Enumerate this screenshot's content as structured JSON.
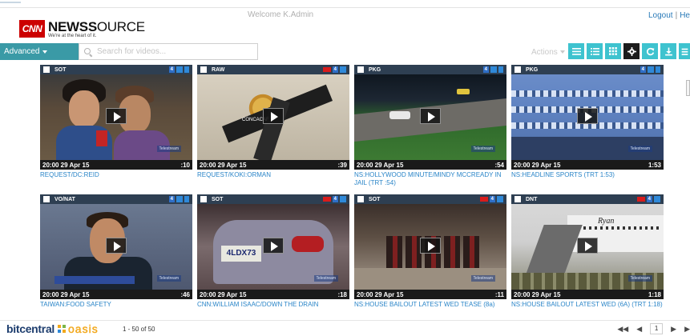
{
  "header": {
    "logo_box": "CNN",
    "logo_bold": "NEWS",
    "logo_light": "OURCE",
    "logo_s": "S",
    "tagline": "We're at the heart of it.",
    "welcome": "Welcome K.Admin",
    "logout": "Logout",
    "help": "He"
  },
  "toolbar": {
    "advanced_label": "Advanced",
    "search_placeholder": "Search for videos...",
    "actions_label": "Actions"
  },
  "cards": [
    {
      "tag": "SOT",
      "badge": "4",
      "timestamp": "20:00 29 Apr 15",
      "duration": ":10",
      "title": "REQUEST/DC:REID",
      "flag": false
    },
    {
      "tag": "RAW",
      "badge": "4",
      "timestamp": "20:00 29 Apr 15",
      "duration": ":39",
      "title": "REQUEST/KOKI:ORMAN",
      "flag": true
    },
    {
      "tag": "PKG",
      "badge": "4",
      "timestamp": "20:00 29 Apr 15",
      "duration": ":54",
      "title": "NS:HOLLYWOOD MINUTE/MINDY MCCREADY IN JAIL (TRT :54)",
      "flag": false
    },
    {
      "tag": "PKG",
      "badge": "4",
      "timestamp": "20:00 29 Apr 15",
      "duration": "1:53",
      "title": "NS:HEADLINE SPORTS (TRT 1:53)",
      "flag": false
    },
    {
      "tag": "VO/NAT",
      "badge": "4",
      "timestamp": "20:00 29 Apr 15",
      "duration": ":46",
      "title": "TAIWAN:FOOD SAFETY",
      "flag": false
    },
    {
      "tag": "SOT",
      "badge": "4",
      "timestamp": "20:00 29 Apr 15",
      "duration": ":18",
      "title": "CNN:WILLIAM ISAAC/DOWN THE DRAIN",
      "flag": true
    },
    {
      "tag": "SOT",
      "badge": "4",
      "timestamp": "20:00 29 Apr 15",
      "duration": ":11",
      "title": "NS:HOUSE BAILOUT LATEST WED TEASE (8a)",
      "flag": true
    },
    {
      "tag": "DNT",
      "badge": "4",
      "timestamp": "20:00 29 Apr 15",
      "duration": "1:18",
      "title": "NS:HOUSE BAILOUT LATEST WED (6A) (TRT 1:18)",
      "flag": true
    }
  ],
  "thumb_text": {
    "watermark": "Telestream",
    "concacaf": "CONCACAF",
    "plate": "4LDX73",
    "ryan": "Ryan"
  },
  "footer": {
    "brand_bit": "bitcentral",
    "brand_oasis": "oasis",
    "page_count": "1 - 50 of 50",
    "current_page": "1"
  },
  "colors": {
    "accent_teal": "#3ec3cf",
    "advanced_teal": "#3a9aa6",
    "card_bar": "#2e3f52",
    "title_link": "#2a85c8",
    "cnn_red": "#cc0000"
  }
}
